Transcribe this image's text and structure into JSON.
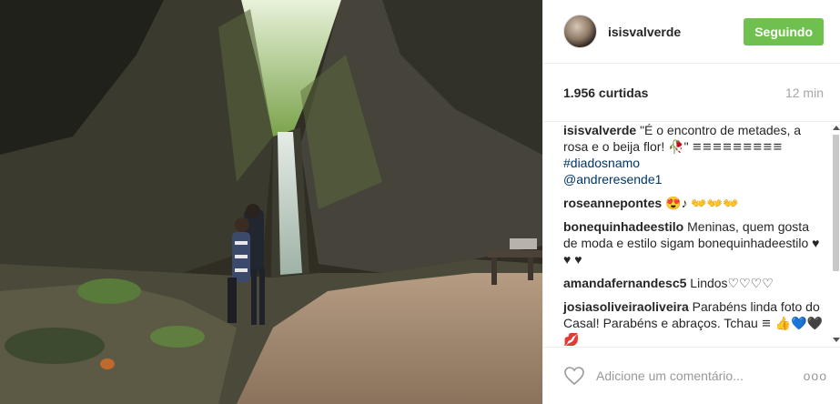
{
  "photo": {
    "icon": "waterfall-couple-photo"
  },
  "header": {
    "username": "isisvalverde",
    "follow_label": "Seguindo"
  },
  "meta": {
    "likes": "1.956 curtidas",
    "time": "12 min"
  },
  "comments": [
    {
      "user": "isisvalverde",
      "text": "\"É o encontro de metades, a rosa e o beija flor! 🥀\" 𑁔𑁔𑁔𑁔𑁔𑁔𑁔𑁔𑁔",
      "tags": [
        "#diadosnamo",
        "@andreresende1"
      ]
    },
    {
      "user": "roseannepontes",
      "text": "😍♪ 👐👐👐"
    },
    {
      "user": "bonequinhadeestilo",
      "text": "Meninas, quem gosta de moda e estilo sigam bonequinhadeestilo ♥ ♥ ♥"
    },
    {
      "user": "amandafernandesc5",
      "text": "Lindos♡♡♡♡"
    },
    {
      "user": "josiasoliveiraoliveira",
      "text": "Parabéns linda foto do Casal! Parabéns e abraços. Tchau 𑁔 👍💙🖤💋"
    }
  ],
  "footer": {
    "placeholder": "Adicione um comentário...",
    "more": "ooo"
  },
  "colors": {
    "follow": "#70c050",
    "tag": "#003569"
  }
}
